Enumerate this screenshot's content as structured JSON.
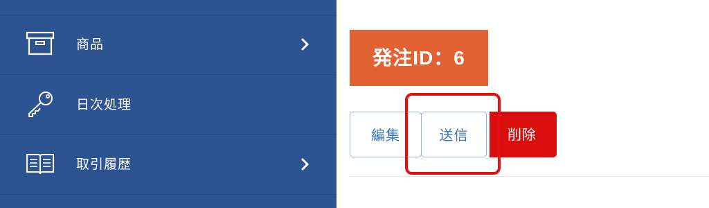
{
  "sidebar": {
    "items": [
      {
        "label": "商品",
        "icon": "archive-box-icon",
        "has_submenu": true
      },
      {
        "label": "日次処理",
        "icon": "key-icon",
        "has_submenu": false
      },
      {
        "label": "取引履歴",
        "icon": "open-book-icon",
        "has_submenu": true
      }
    ]
  },
  "main": {
    "title": "発注ID：6",
    "actions": {
      "edit_label": "編集",
      "send_label": "送信",
      "delete_label": "削除"
    }
  },
  "colors": {
    "sidebar_bg": "#2e5391",
    "title_bg": "#e36233",
    "outline_button": "#3a78bb",
    "delete_button": "#db0e0e",
    "highlight": "#e40f0f"
  }
}
